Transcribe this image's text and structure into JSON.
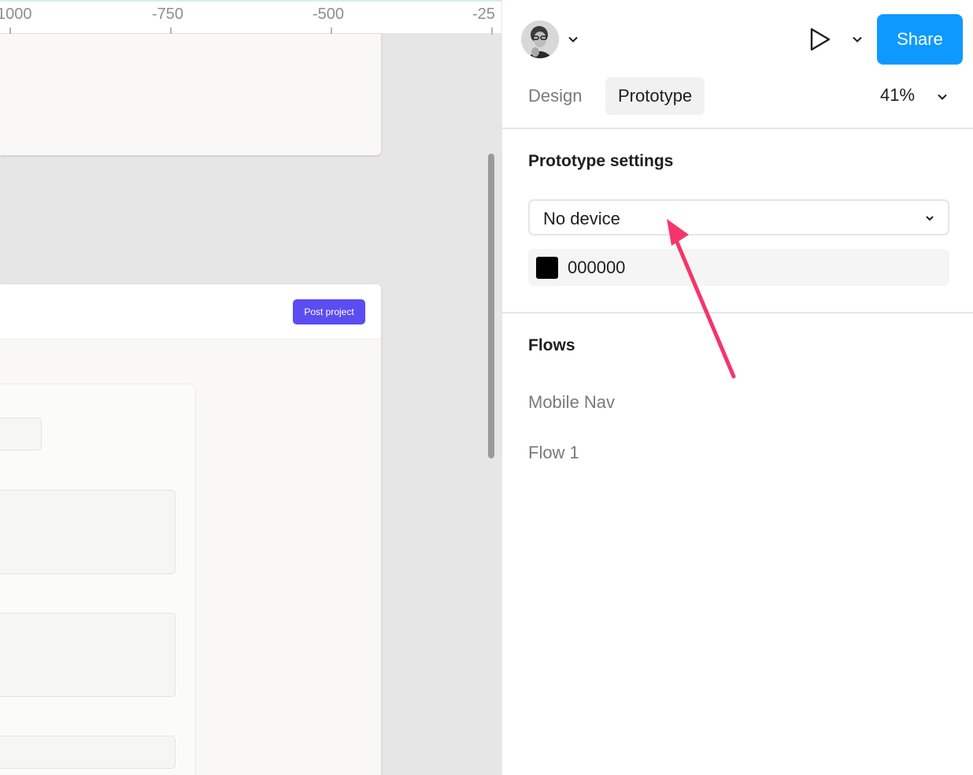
{
  "ruler": {
    "ticks": [
      "1000",
      "-750",
      "-500",
      "-25"
    ]
  },
  "canvas": {
    "post_project_label": "Post project"
  },
  "header": {
    "share_label": "Share"
  },
  "tabs": {
    "design_label": "Design",
    "prototype_label": "Prototype",
    "active": "Prototype"
  },
  "zoom": {
    "value": "41%"
  },
  "prototype_settings": {
    "title": "Prototype settings",
    "device_value": "No device",
    "background_color": "000000"
  },
  "flows": {
    "title": "Flows",
    "items": [
      {
        "label": "Mobile Nav"
      },
      {
        "label": "Flow 1"
      }
    ]
  },
  "colors": {
    "accent_share": "#0d99ff",
    "post_button": "#5b4df1",
    "annotation_arrow": "#f5356b"
  }
}
